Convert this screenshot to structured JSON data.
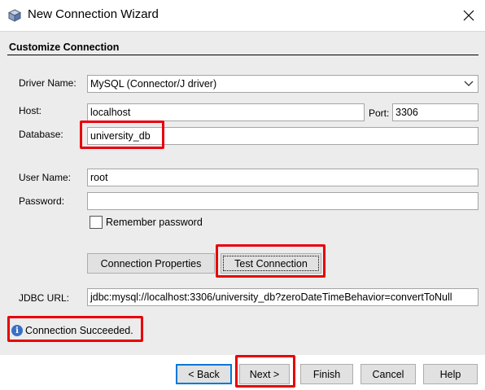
{
  "window": {
    "title": "New Connection Wizard",
    "icon": "cube-icon",
    "close_icon": "close-icon"
  },
  "header": {
    "step_title": "Customize Connection"
  },
  "form": {
    "driver": {
      "label": "Driver Name:",
      "value": "MySQL (Connector/J driver)"
    },
    "host": {
      "label": "Host:",
      "value": "localhost"
    },
    "port": {
      "label": "Port:",
      "value": "3306"
    },
    "database": {
      "label": "Database:",
      "value": "university_db"
    },
    "username": {
      "label": "User Name:",
      "value": "root"
    },
    "password": {
      "label": "Password:",
      "value": ""
    },
    "remember": {
      "label": "Remember password",
      "checked": false
    },
    "conn_props_label": "Connection Properties",
    "test_conn_label": "Test Connection",
    "jdbc": {
      "label": "JDBC URL:",
      "value": "jdbc:mysql://localhost:3306/university_db?zeroDateTimeBehavior=convertToNull"
    }
  },
  "status": {
    "icon": "info-icon",
    "glyph": "i",
    "message": "Connection Succeeded."
  },
  "buttons": {
    "back": "< Back",
    "next": "Next >",
    "finish": "Finish",
    "cancel": "Cancel",
    "help": "Help"
  },
  "colors": {
    "highlight": "#e8000b",
    "panel_bg": "#ececec",
    "info_blue": "#3b6fc4",
    "focus_blue": "#0078d7"
  }
}
